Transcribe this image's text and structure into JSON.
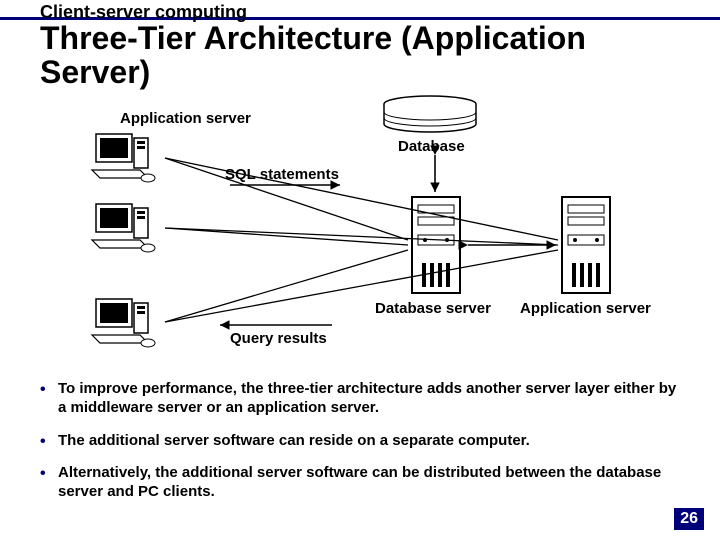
{
  "section": "Client-server computing",
  "title": "Three-Tier Architecture (Application Server)",
  "diagram": {
    "label_app_server_top": "Application server",
    "label_database": "Database",
    "label_sql": "SQL statements",
    "label_db_server": "Database server",
    "label_app_server_bottom": "Application server",
    "label_query_results": "Query results"
  },
  "bullets": [
    "To improve performance, the three-tier architecture adds another server layer either by a middleware server or an application server.",
    "The additional server software can reside on a separate computer.",
    "Alternatively, the additional server software can be distributed between the database server and PC clients."
  ],
  "page_number": "26"
}
